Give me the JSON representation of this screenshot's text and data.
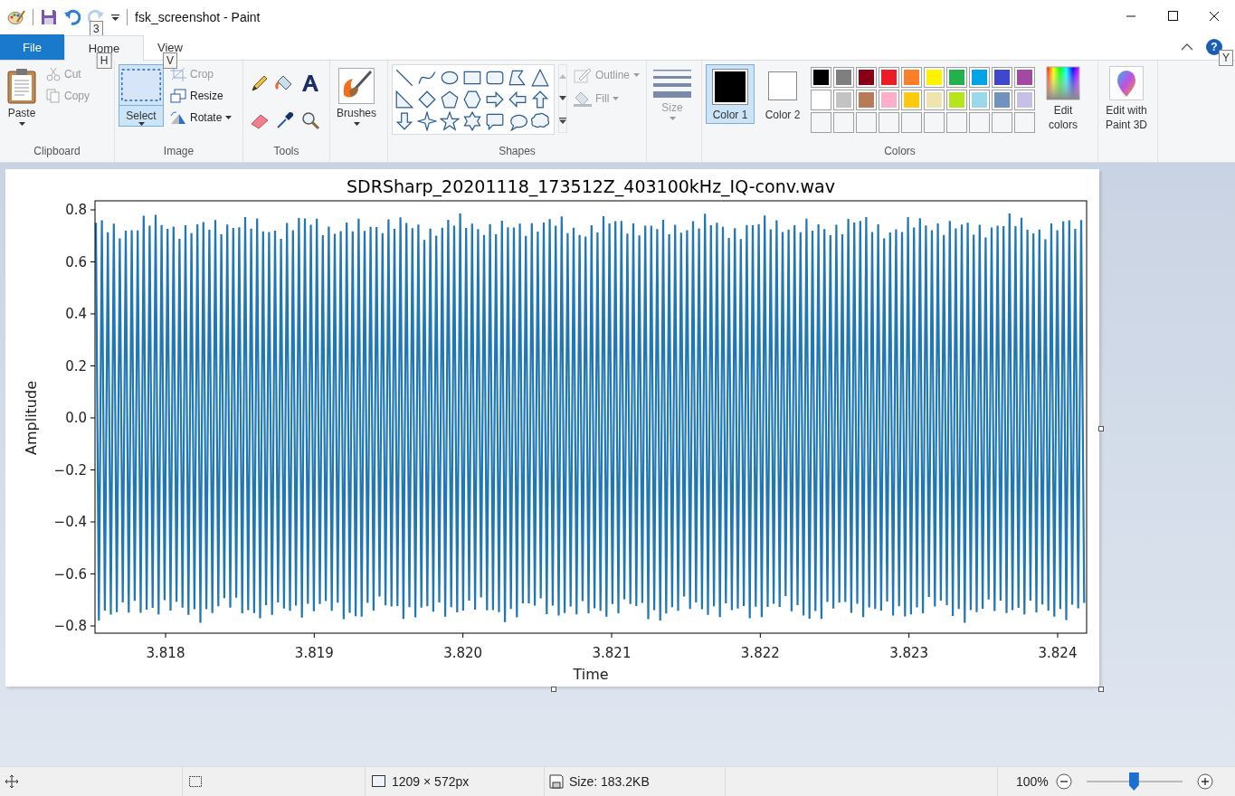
{
  "window": {
    "title": "fsk_screenshot - Paint"
  },
  "quick_access": [
    {
      "kind": "save",
      "disabled": false
    },
    {
      "kind": "undo",
      "disabled": false
    },
    {
      "kind": "redo",
      "disabled": true,
      "keytip": "3"
    }
  ],
  "tabs": [
    {
      "label": "File",
      "kind": "file",
      "selected": false
    },
    {
      "label": "Home",
      "kind": "tab",
      "selected": true,
      "keytip": "H"
    },
    {
      "label": "View",
      "kind": "tab",
      "selected": false,
      "keytip": "V"
    }
  ],
  "help": {
    "label": "?",
    "keytip": "Y"
  },
  "clipboard": {
    "label": "Clipboard",
    "paste": "Paste",
    "cut": {
      "label": "Cut",
      "disabled": true
    },
    "copy": {
      "label": "Copy",
      "disabled": true
    }
  },
  "image_group": {
    "label": "Image",
    "select": {
      "label": "Select",
      "selected": true
    },
    "crop": {
      "label": "Crop",
      "disabled": true
    },
    "resize": {
      "label": "Resize",
      "disabled": false
    },
    "rotate": {
      "label": "Rotate",
      "disabled": false
    }
  },
  "tools": {
    "label": "Tools"
  },
  "brushes": {
    "label": "Brushes"
  },
  "shapes": {
    "label": "Shapes",
    "outline": {
      "label": "Outline",
      "disabled": true
    },
    "fill": {
      "label": "Fill",
      "disabled": true
    }
  },
  "size": {
    "label": "Size",
    "disabled": true
  },
  "colors": {
    "label": "Colors",
    "color1": {
      "label": "Color 1",
      "color": "#000000",
      "selected": true
    },
    "color2": {
      "label": "Color 2",
      "color": "#ffffff",
      "selected": false
    },
    "edit_colors": "Edit colors",
    "palette": [
      {
        "kind": "color",
        "color": "#000000"
      },
      {
        "kind": "color",
        "color": "#7f7f7f"
      },
      {
        "kind": "color",
        "color": "#880015"
      },
      {
        "kind": "color",
        "color": "#ed1c24"
      },
      {
        "kind": "color",
        "color": "#ff7f27"
      },
      {
        "kind": "color",
        "color": "#fff200"
      },
      {
        "kind": "color",
        "color": "#22b14c"
      },
      {
        "kind": "color",
        "color": "#00a2e8"
      },
      {
        "kind": "color",
        "color": "#3f48cc"
      },
      {
        "kind": "color",
        "color": "#a349a4"
      },
      {
        "kind": "color",
        "color": "#ffffff"
      },
      {
        "kind": "color",
        "color": "#c3c3c3"
      },
      {
        "kind": "color",
        "color": "#b97a57"
      },
      {
        "kind": "color",
        "color": "#ffaec9"
      },
      {
        "kind": "color",
        "color": "#ffc90e"
      },
      {
        "kind": "color",
        "color": "#efe4b0"
      },
      {
        "kind": "color",
        "color": "#b5e61d"
      },
      {
        "kind": "color",
        "color": "#99d9ea"
      },
      {
        "kind": "color",
        "color": "#7092be"
      },
      {
        "kind": "color",
        "color": "#c8bfe7"
      },
      {
        "kind": "empty"
      },
      {
        "kind": "empty"
      },
      {
        "kind": "empty"
      },
      {
        "kind": "empty"
      },
      {
        "kind": "empty"
      },
      {
        "kind": "empty"
      },
      {
        "kind": "empty"
      },
      {
        "kind": "empty"
      },
      {
        "kind": "empty"
      },
      {
        "kind": "empty"
      }
    ]
  },
  "paint3d": {
    "label": "Edit with Paint 3D"
  },
  "image": {
    "title": "SDRSharp_20201118_173512Z_403100kHz_IQ-conv.wav",
    "xlabel": "Time",
    "ylabel": "Amplitude",
    "yticks": [
      "0.8",
      "0.6",
      "0.4",
      "0.2",
      "0.0",
      "−0.2",
      "−0.4",
      "−0.6",
      "−0.8"
    ],
    "xticks": [
      "3.818",
      "3.819",
      "3.820",
      "3.821",
      "3.822",
      "3.823",
      "3.824"
    ]
  },
  "status_bar": {
    "dimensions": "1209 × 572px",
    "size": "Size: 183.2KB",
    "zoom": "100%",
    "level": 0.5
  }
}
